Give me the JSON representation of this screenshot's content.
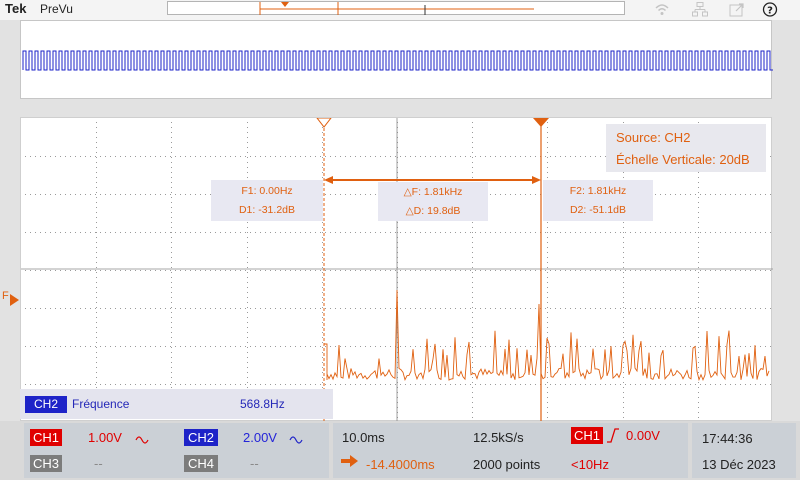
{
  "app": {
    "brand": "Tek",
    "mode": "PreVu"
  },
  "source_panel": {
    "source": "Source: CH2",
    "vertical_scale": "Échelle Verticale: 20dB"
  },
  "cursor1": {
    "freq": "F1: 0.00Hz",
    "level": "D1: -31.2dB"
  },
  "cursor2": {
    "freq": "F2: 1.81kHz",
    "level": "D2: -51.1dB"
  },
  "delta": {
    "freq": "△F: 1.81kHz",
    "level": "△D: 19.8dB"
  },
  "trace_marker": "F",
  "measurement": {
    "channel": "CH2",
    "label": "Fréquence",
    "value": "568.8Hz"
  },
  "channels": {
    "ch1": {
      "label": "CH1",
      "scale": "1.00V",
      "coupling_icon": "ac-coupling-icon",
      "color": "#e00000"
    },
    "ch2": {
      "label": "CH2",
      "scale": "2.00V",
      "coupling_icon": "ac-coupling-icon",
      "color": "#1e23c8"
    },
    "ch3": {
      "label": "CH3",
      "scale": "--"
    },
    "ch4": {
      "label": "CH4",
      "scale": "--"
    }
  },
  "horizontal": {
    "time_div": "10.0ms",
    "sample_rate": "12.5kS/s",
    "position": "-14.4000ms",
    "record_length": "2000 points"
  },
  "trigger": {
    "source": "CH1",
    "level": "0.00V",
    "frequency": "<10Hz",
    "slope_icon": "rising-edge-icon"
  },
  "clock": {
    "time": "17:44:36",
    "date": "13 Déc 2023"
  },
  "colors": {
    "ch1": "#e00000",
    "ch2": "#1e23c8",
    "math": "#e06010",
    "badge_grey": "#7c7c7c"
  },
  "icons": [
    "wifi-icon",
    "network-icon",
    "export-icon",
    "help-icon"
  ]
}
